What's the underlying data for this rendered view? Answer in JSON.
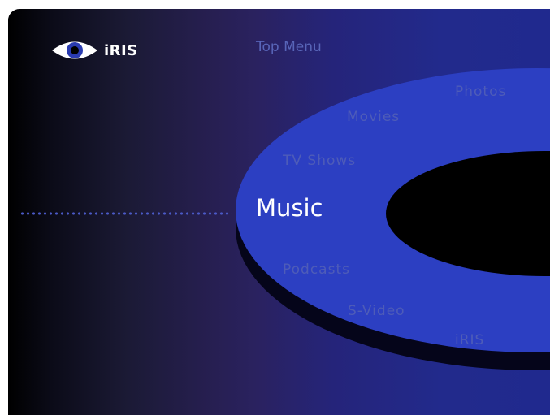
{
  "app": {
    "logo_text": "iRIS"
  },
  "header": {
    "top_menu_label": "Top Menu"
  },
  "menu": {
    "items": [
      {
        "label": "Photos"
      },
      {
        "label": "Movies"
      },
      {
        "label": "TV Shows"
      },
      {
        "label": "Music",
        "selected": true
      },
      {
        "label": "Podcasts"
      },
      {
        "label": "S-Video"
      },
      {
        "label": "iRIS"
      }
    ]
  },
  "colors": {
    "ring": "#2c3fc2",
    "ring_shadow": "#000000",
    "selected_text": "#ffffff",
    "unselected_text": "#4e5cb8"
  },
  "icons": {
    "logo": "eye-icon",
    "selection_indicator": "dotted-line"
  }
}
